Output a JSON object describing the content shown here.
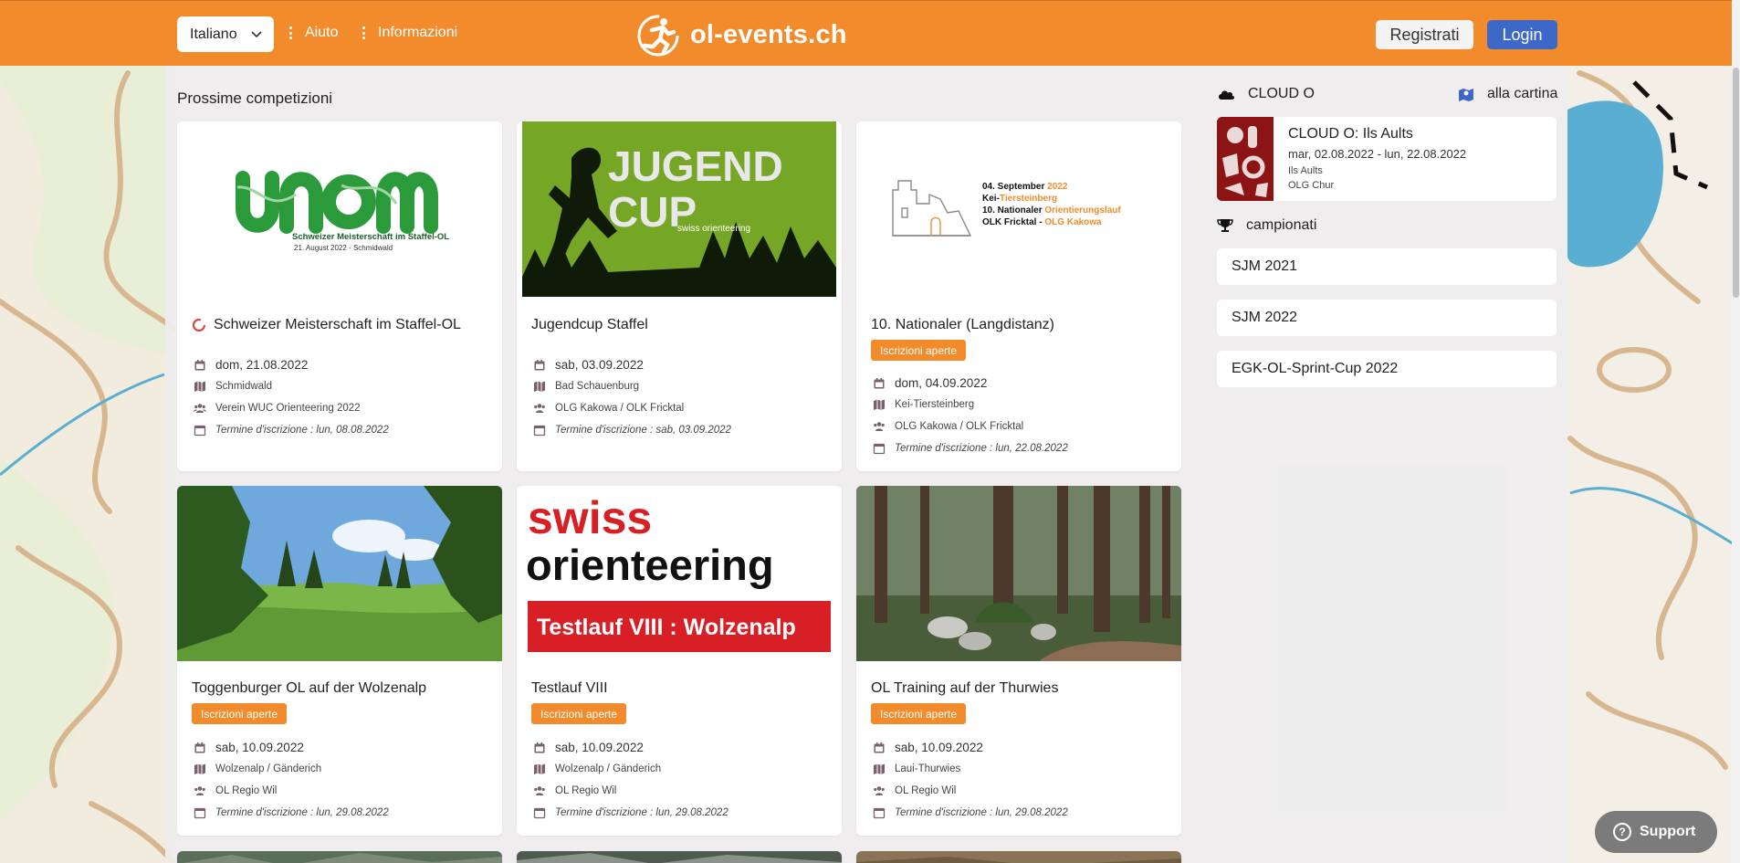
{
  "header": {
    "language": "Italiano",
    "nav": [
      "Aiuto",
      "Informazioni"
    ],
    "logo_text": "ol-events.ch",
    "register_label": "Registrati",
    "login_label": "Login"
  },
  "main": {
    "section_title": "Prossime competizioni",
    "cards": [
      {
        "title": "Schweizer Meisterschaft im Staffel-OL",
        "status_icon": "loading-ring-icon",
        "badge": "",
        "date": "dom, 21.08.2022",
        "location": "Schmidwald",
        "organizer": "Verein WUC Orienteering 2022",
        "deadline": "Termine d'iscrizione : lun, 08.08.2022",
        "image": {
          "type": "logo",
          "caption": "Schweizer Meisterschaft im Staffel-OL",
          "subcaption": "21. August 2022 - Schmidwald"
        }
      },
      {
        "title": "Jugendcup Staffel",
        "badge": "",
        "date": "sab, 03.09.2022",
        "location": "Bad Schauenburg",
        "organizer": "OLG Kakowa / OLK Fricktal",
        "deadline": "Termine d'iscrizione : sab, 03.09.2022",
        "image": {
          "type": "poster",
          "line1": "JUGEND",
          "line2": "CUP",
          "line3": "swiss orienteering"
        }
      },
      {
        "title": "10. Nationaler (Langdistanz)",
        "badge": "Iscrizioni aperte",
        "date": "dom, 04.09.2022",
        "location": "Kei-Tiersteinberg",
        "organizer": "OLG Kakowa / OLK Fricktal",
        "deadline": "Termine d'iscrizione : lun, 22.08.2022",
        "image": {
          "type": "castle",
          "l1a": "04. September ",
          "l1b": "2022",
          "l2a": "Kei-",
          "l2b": "Tiersteinberg",
          "l3a": "10. Nationaler ",
          "l3b": "Orientierungslauf",
          "l4a": "OLK Fricktal - ",
          "l4b": "OLG Kakowa"
        }
      },
      {
        "title": "Toggenburger OL auf der Wolzenalp",
        "badge": "Iscrizioni aperte",
        "date": "sab, 10.09.2022",
        "location": "Wolzenalp / Gänderich",
        "organizer": "OL Regio Wil",
        "deadline": "Termine d'iscrizione : lun, 29.08.2022",
        "image": {
          "type": "meadow"
        }
      },
      {
        "title": "Testlauf VIII",
        "badge": "Iscrizioni aperte",
        "date": "sab, 10.09.2022",
        "location": "Wolzenalp / Gänderich",
        "organizer": "OL Regio Wil",
        "deadline": "Termine d'iscrizione : lun, 29.08.2022",
        "image": {
          "type": "swiss",
          "line1": "swiss",
          "line2": "orienteering",
          "banner": "Testlauf VIII : Wolzenalp"
        }
      },
      {
        "title": "OL Training auf der Thurwies",
        "badge": "Iscrizioni aperte",
        "date": "sab, 10.09.2022",
        "location": "Laui-Thurwies",
        "organizer": "OL Regio Wil",
        "deadline": "Termine d'iscrizione : lun, 29.08.2022",
        "image": {
          "type": "forest"
        }
      }
    ]
  },
  "sidebar": {
    "cloud_head": "CLOUD O",
    "map_link": "alla cartina",
    "cloud_event": {
      "title": "CLOUD O: Ils Aults",
      "dates": "mar, 02.08.2022 - lun, 22.08.2022",
      "location": "Ils Aults",
      "organizer": "OLG Chur"
    },
    "champ_head": "campionati",
    "championships": [
      "SJM 2021",
      "SJM 2022",
      "EGK-OL-Sprint-Cup 2022"
    ]
  },
  "support_label": "Support",
  "colors": {
    "brand_orange": "#f28b2c",
    "login_blue": "#3d68c7"
  }
}
